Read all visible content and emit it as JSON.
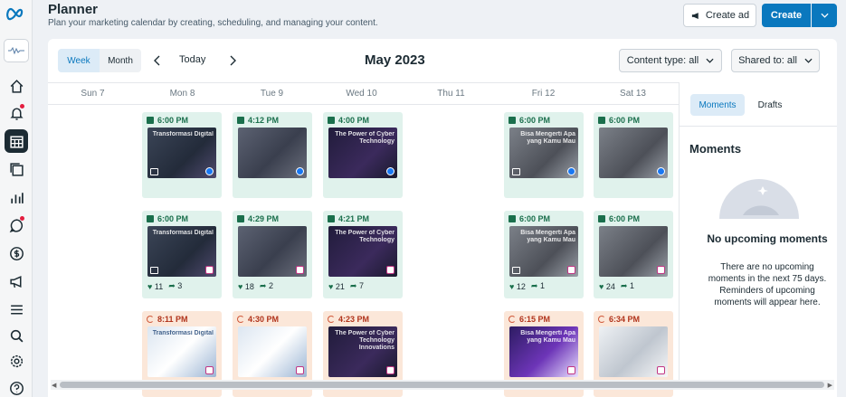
{
  "header": {
    "title": "Planner",
    "subtitle": "Plan your marketing calendar by creating, scheduling, and managing your content.",
    "create_ad_label": "Create ad",
    "create_label": "Create"
  },
  "toolbar": {
    "week_label": "Week",
    "month_label": "Month",
    "today_label": "Today",
    "period_title": "May 2023",
    "content_type_filter": "Content type: all",
    "shared_to_filter": "Shared to: all"
  },
  "days": [
    "Sun 7",
    "Mon 8",
    "Tue 9",
    "Wed 10",
    "Thu 11",
    "Fri 12",
    "Sat 13"
  ],
  "row1": [
    {
      "day": "Mon 8",
      "time": "6:00 PM",
      "text": "Transformasi Digital",
      "platform": "facebook"
    },
    {
      "day": "Tue 9",
      "time": "4:12 PM",
      "text": "",
      "platform": "facebook"
    },
    {
      "day": "Wed 10",
      "time": "4:00 PM",
      "text": "The Power of Cyber Technology",
      "platform": "facebook"
    },
    {
      "day": "Fri 12",
      "time": "6:00 PM",
      "text": "Bisa Mengerti Apa yang Kamu Mau",
      "platform": "facebook"
    },
    {
      "day": "Sat 13",
      "time": "6:00 PM",
      "text": "",
      "platform": "facebook"
    }
  ],
  "row2": [
    {
      "day": "Mon 8",
      "time": "6:00 PM",
      "text": "Transformasi Digital",
      "platform": "instagram",
      "likes": "11",
      "shares": "3"
    },
    {
      "day": "Tue 9",
      "time": "4:29 PM",
      "text": "",
      "platform": "instagram",
      "likes": "18",
      "shares": "2"
    },
    {
      "day": "Wed 10",
      "time": "4:21 PM",
      "text": "The Power of Cyber Technology",
      "platform": "instagram",
      "likes": "21",
      "shares": "7"
    },
    {
      "day": "Fri 12",
      "time": "6:00 PM",
      "text": "Bisa Mengerti Apa yang Kamu Mau",
      "platform": "instagram",
      "likes": "12",
      "shares": "1"
    },
    {
      "day": "Sat 13",
      "time": "6:00 PM",
      "text": "",
      "platform": "instagram",
      "likes": "24",
      "shares": "1"
    }
  ],
  "row3": [
    {
      "day": "Mon 8",
      "time": "8:11 PM",
      "text": "Transformasi Digital",
      "platform": "instagram"
    },
    {
      "day": "Tue 9",
      "time": "4:30 PM",
      "text": "",
      "platform": "instagram"
    },
    {
      "day": "Wed 10",
      "time": "4:23 PM",
      "text": "The Power of Cyber Technology Innovations",
      "platform": "instagram"
    },
    {
      "day": "Fri 12",
      "time": "6:15 PM",
      "text": "Bisa Mengerti Apa yang Kamu Mau",
      "platform": "instagram"
    },
    {
      "day": "Sat 13",
      "time": "6:34 PM",
      "text": "",
      "platform": "instagram"
    }
  ],
  "right_panel": {
    "tab_moments": "Moments",
    "tab_drafts": "Drafts",
    "section_title": "Moments",
    "empty_title": "No upcoming moments",
    "empty_text": "There are no upcoming moments in the next 75 days. Reminders of upcoming moments will appear here."
  },
  "colors": {
    "accent": "#0a78be",
    "published_bg": "#e0f2ec",
    "scheduled_bg": "#fbe7d9"
  }
}
